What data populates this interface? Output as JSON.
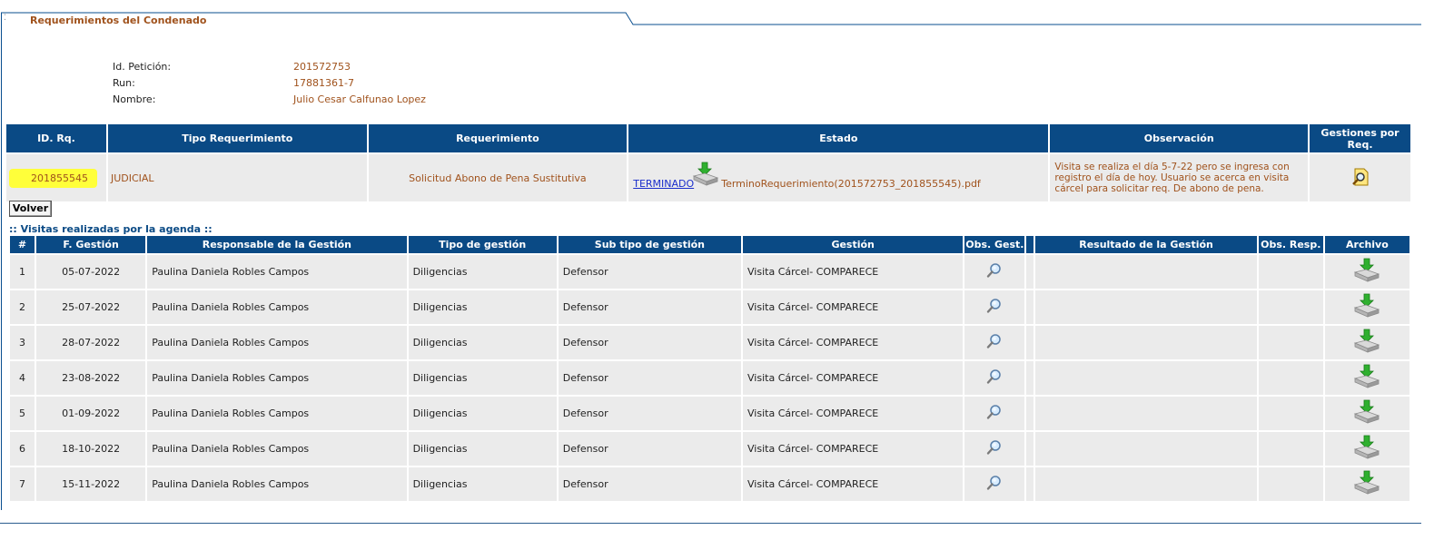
{
  "tab": {
    "title": "Requerimientos del Condenado"
  },
  "info": [
    {
      "label": "Id. Petición:",
      "value": "201572753"
    },
    {
      "label": "Run:",
      "value": "17881361-7"
    },
    {
      "label": "Nombre:",
      "value": "Julio Cesar Calfunao Lopez"
    }
  ],
  "requirements": {
    "headers": [
      "ID. Rq.",
      "Tipo Requerimiento",
      "Requerimiento",
      "Estado",
      "Observación",
      "Gestiones por Req."
    ],
    "row": {
      "id": "201855545",
      "tipo": "JUDICIAL",
      "requerimiento": "Solicitud Abono de Pena Sustitutiva",
      "estado_link": "TERMINADO",
      "estado_file": "TerminoRequerimiento(201572753_201855545).pdf",
      "observacion": "Visita se realiza el día 5-7-22 pero se ingresa con registro el día de hoy. Usuario se acerca en visita cárcel para solicitar req. De abono de pena."
    }
  },
  "volver_label": "Volver",
  "visits": {
    "title": ":: Visitas realizadas por la agenda ::",
    "headers": [
      "#",
      "F. Gestión",
      "Responsable de la Gestión",
      "Tipo de gestión",
      "Sub tipo de gestión",
      "Gestión",
      "Obs. Gest.",
      "",
      "Resultado de la Gestión",
      "Obs. Resp.",
      "Archivo"
    ],
    "rows": [
      {
        "n": "1",
        "fecha": "05-07-2022",
        "responsable": "Paulina Daniela Robles Campos",
        "tipo": "Diligencias",
        "subtipo": "Defensor",
        "gestion": "Visita Cárcel- COMPARECE"
      },
      {
        "n": "2",
        "fecha": "25-07-2022",
        "responsable": "Paulina Daniela Robles Campos",
        "tipo": "Diligencias",
        "subtipo": "Defensor",
        "gestion": "Visita Cárcel- COMPARECE"
      },
      {
        "n": "3",
        "fecha": "28-07-2022",
        "responsable": "Paulina Daniela Robles Campos",
        "tipo": "Diligencias",
        "subtipo": "Defensor",
        "gestion": "Visita Cárcel- COMPARECE"
      },
      {
        "n": "4",
        "fecha": "23-08-2022",
        "responsable": "Paulina Daniela Robles Campos",
        "tipo": "Diligencias",
        "subtipo": "Defensor",
        "gestion": "Visita Cárcel- COMPARECE"
      },
      {
        "n": "5",
        "fecha": "01-09-2022",
        "responsable": "Paulina Daniela Robles Campos",
        "tipo": "Diligencias",
        "subtipo": "Defensor",
        "gestion": "Visita Cárcel- COMPARECE"
      },
      {
        "n": "6",
        "fecha": "18-10-2022",
        "responsable": "Paulina Daniela Robles Campos",
        "tipo": "Diligencias",
        "subtipo": "Defensor",
        "gestion": "Visita Cárcel- COMPARECE"
      },
      {
        "n": "7",
        "fecha": "15-11-2022",
        "responsable": "Paulina Daniela Robles Campos",
        "tipo": "Diligencias",
        "subtipo": "Defensor",
        "gestion": "Visita Cárcel- COMPARECE"
      }
    ]
  },
  "colors": {
    "header_bg": "#0a4a85",
    "value_text": "#a0521c",
    "highlight": "#ffff3a",
    "link": "#1a2ecc"
  }
}
